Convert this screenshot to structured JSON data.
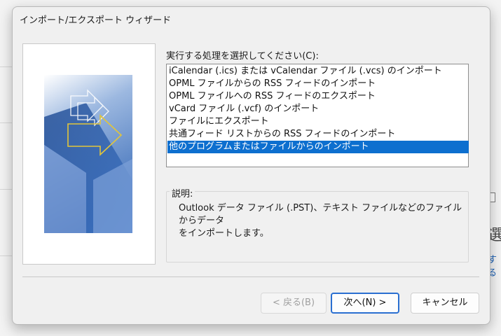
{
  "dialog": {
    "title": "インポート/エクスポート ウィザード",
    "prompt": "実行する処理を選択してください(C):",
    "actions": [
      {
        "label": "iCalendar (.ics) または vCalendar ファイル (.vcs) のインポート",
        "selected": false
      },
      {
        "label": "OPML ファイルからの RSS フィードのインポート",
        "selected": false
      },
      {
        "label": "OPML ファイルへの RSS フィードのエクスポート",
        "selected": false
      },
      {
        "label": "vCard ファイル (.vcf) のインポート",
        "selected": false
      },
      {
        "label": "ファイルにエクスポート",
        "selected": false
      },
      {
        "label": "共通フィード リストからの RSS フィードのインポート",
        "selected": false
      },
      {
        "label": "他のプログラムまたはファイルからのインポート",
        "selected": true
      }
    ],
    "description": {
      "legend": "説明:",
      "text_line1": "Outlook データ ファイル (.PST)、テキスト ファイルなどのファイルからデータ",
      "text_line2": "をインポートします。"
    },
    "buttons": {
      "back": "< 戻る(B)",
      "next": "次へ(N) >",
      "cancel": "キャンセル"
    }
  },
  "background": {
    "partial_char": "選",
    "partial_link": "する"
  },
  "colors": {
    "selection": "#0d6fcf",
    "default_button_border": "#2a6fd1",
    "art_blue": "#2f5fa8",
    "art_arrow": "#e2c53a"
  },
  "icons": {
    "wizard_art": "import-export-arrows-graphic"
  }
}
